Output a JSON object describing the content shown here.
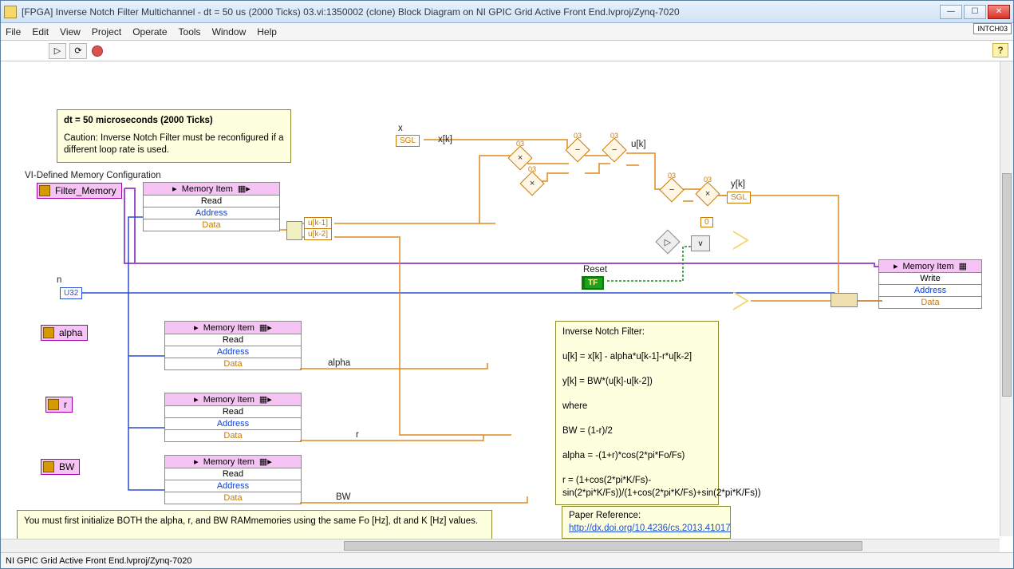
{
  "window": {
    "title": "[FPGA] Inverse Notch Filter Multichannel - dt = 50 us (2000 Ticks) 03.vi:1350002 (clone) Block Diagram on NI GPIC Grid Active Front End.lvproj/Zynq-7020",
    "tag": "INTCH03"
  },
  "menu": [
    "File",
    "Edit",
    "View",
    "Project",
    "Operate",
    "Tools",
    "Window",
    "Help"
  ],
  "toolbar": {
    "help": "?"
  },
  "status": "NI GPIC Grid Active Front End.lvproj/Zynq-7020",
  "notes": {
    "dt_header": "dt = 50 microseconds (2000 Ticks)",
    "dt_body": "Caution: Inverse Notch Filter must be reconfigured if a different loop rate is used.",
    "vi_cfg": "VI-Defined Memory Configuration",
    "init_warning": "You must first initialize BOTH the alpha, r, and BW RAMmemories using the same Fo [Hz], dt and K [Hz] values.\n\nCAUTION: Incorrect combinations of alpha and r values may be numerically unstable.",
    "filter_math": "Inverse Notch Filter:\n\nu[k] = x[k] - alpha*u[k-1]-r*u[k-2]\n\ny[k] = BW*(u[k]-u[k-2])\n\nwhere\n\nBW = (1-r)/2\n\nalpha = -(1+r)*cos(2*pi*Fo/Fs)\n\nr = (1+cos(2*pi*K/Fs)-sin(2*pi*K/Fs))/(1+cos(2*pi*K/Fs)+sin(2*pi*K/Fs))",
    "paper_ref_label": "Paper Reference:",
    "paper_ref_url": "http://dx.doi.org/10.4236/cs.2013.41017"
  },
  "terminals": {
    "filter_memory": "Filter_Memory",
    "alpha": "alpha",
    "r": "r",
    "bw": "BW"
  },
  "signals": {
    "n": "n",
    "n_type": "U32",
    "x": "x",
    "x_type": "SGL",
    "xk": "x[k]",
    "uk": "u[k]",
    "yk": "y[k]",
    "yk_type": "SGL",
    "uk1": "u[k-1]",
    "uk2": "u[k-2]",
    "reset": "Reset",
    "reset_val": "TF",
    "zero": "0",
    "alpha_wire": "alpha",
    "r_wire": "r",
    "bw_wire": "BW",
    "sel_v": "v"
  },
  "memory": {
    "title": "Memory Item",
    "read": "Read",
    "write": "Write",
    "address": "Address",
    "data": "Data"
  },
  "ops": {
    "mult_lbl": "03"
  }
}
